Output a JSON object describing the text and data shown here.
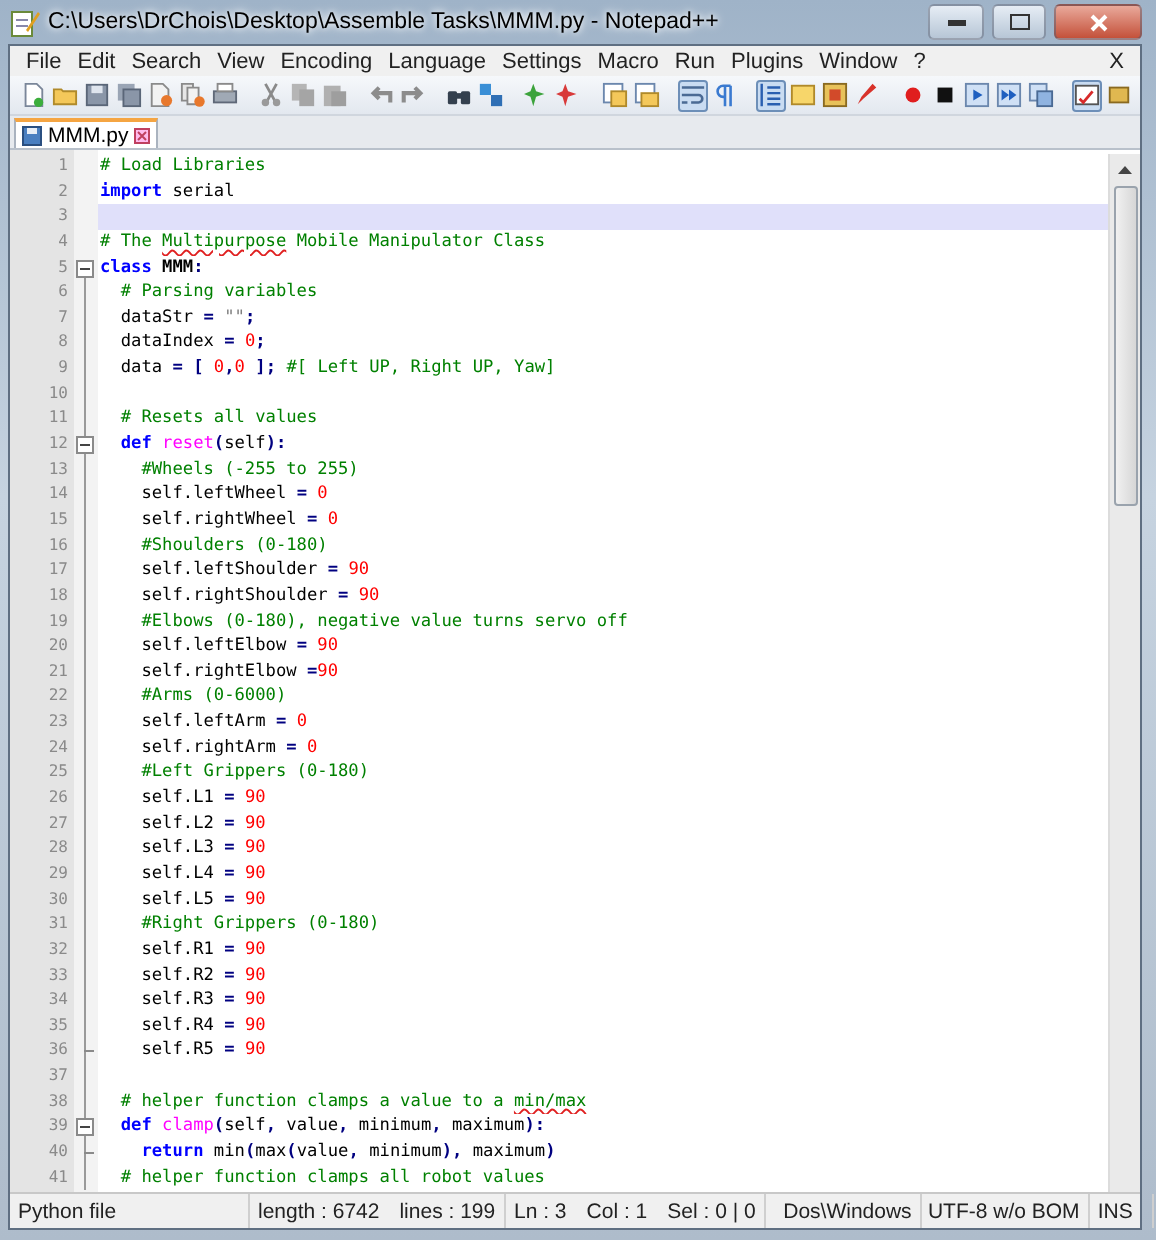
{
  "window": {
    "title": "C:\\Users\\DrChois\\Desktop\\Assemble Tasks\\MMM.py - Notepad++"
  },
  "menu": [
    {
      "label": "File"
    },
    {
      "label": "Edit"
    },
    {
      "label": "Search"
    },
    {
      "label": "View"
    },
    {
      "label": "Encoding"
    },
    {
      "label": "Language"
    },
    {
      "label": "Settings"
    },
    {
      "label": "Macro"
    },
    {
      "label": "Run"
    },
    {
      "label": "Plugins"
    },
    {
      "label": "Window"
    },
    {
      "label": "?"
    }
  ],
  "menu_close": "X",
  "toolbar": [
    {
      "kind": "new",
      "pressed": false
    },
    {
      "kind": "open",
      "pressed": false
    },
    {
      "kind": "save",
      "pressed": false
    },
    {
      "kind": "saveall",
      "pressed": false
    },
    {
      "kind": "close",
      "pressed": false
    },
    {
      "kind": "closeall",
      "pressed": false
    },
    {
      "kind": "print",
      "pressed": false
    },
    {
      "kind": "sep"
    },
    {
      "kind": "cut",
      "pressed": false
    },
    {
      "kind": "copy",
      "pressed": false
    },
    {
      "kind": "paste",
      "pressed": false
    },
    {
      "kind": "sep"
    },
    {
      "kind": "undo",
      "pressed": false
    },
    {
      "kind": "redo",
      "pressed": false
    },
    {
      "kind": "sep"
    },
    {
      "kind": "find",
      "pressed": false
    },
    {
      "kind": "replace",
      "pressed": false
    },
    {
      "kind": "sep"
    },
    {
      "kind": "zoomin",
      "pressed": false
    },
    {
      "kind": "zoomout",
      "pressed": false
    },
    {
      "kind": "sep"
    },
    {
      "kind": "syncv",
      "pressed": false
    },
    {
      "kind": "synch",
      "pressed": false
    },
    {
      "kind": "sep"
    },
    {
      "kind": "wrap",
      "pressed": true
    },
    {
      "kind": "pilcrow",
      "pressed": false
    },
    {
      "kind": "sep"
    },
    {
      "kind": "guide",
      "pressed": true
    },
    {
      "kind": "panel",
      "pressed": false
    },
    {
      "kind": "docmap",
      "pressed": false
    },
    {
      "kind": "pen",
      "pressed": false
    },
    {
      "kind": "sep"
    },
    {
      "kind": "record",
      "pressed": false
    },
    {
      "kind": "stop",
      "pressed": false
    },
    {
      "kind": "play",
      "pressed": false
    },
    {
      "kind": "playmulti",
      "pressed": false
    },
    {
      "kind": "savemacro",
      "pressed": false
    },
    {
      "kind": "sep"
    },
    {
      "kind": "spell",
      "pressed": true
    },
    {
      "kind": "extra",
      "pressed": false
    }
  ],
  "tabs": [
    {
      "label": "MMM.py",
      "selected": true
    }
  ],
  "editor": {
    "lines": [
      {
        "number": "1",
        "current": false,
        "tokens": [
          {
            "kind": "comment",
            "text": "# Load Libraries"
          }
        ]
      },
      {
        "number": "2",
        "current": false,
        "tokens": [
          {
            "kind": "keyword",
            "text": "import"
          },
          {
            "kind": "plain",
            "text": " serial"
          }
        ]
      },
      {
        "number": "3",
        "current": true
      },
      {
        "number": "4",
        "current": false,
        "tokens": [
          {
            "kind": "comment",
            "text": "# The "
          },
          {
            "kind": "typo",
            "text": "Multipurpose"
          },
          {
            "kind": "comment",
            "text": " Mobile Manipulator Class"
          }
        ]
      },
      {
        "number": "5",
        "current": false,
        "fold_start": true,
        "tokens": [
          {
            "kind": "keyword",
            "text": "class"
          },
          {
            "kind": "classname",
            "text": " MMM"
          },
          {
            "kind": "operator",
            "text": ":"
          }
        ]
      },
      {
        "number": "6",
        "current": false,
        "tokens": [
          {
            "kind": "comment",
            "text": "  # Parsing variables"
          }
        ]
      },
      {
        "number": "7",
        "current": false,
        "tokens": [
          {
            "kind": "plain",
            "text": "  dataStr "
          },
          {
            "kind": "operator",
            "text": "="
          },
          {
            "kind": "string",
            "text": " \"\""
          },
          {
            "kind": "operator",
            "text": ";"
          }
        ]
      },
      {
        "number": "8",
        "current": false,
        "tokens": [
          {
            "kind": "plain",
            "text": "  dataIndex "
          },
          {
            "kind": "operator",
            "text": "="
          },
          {
            "kind": "number",
            "text": " 0"
          },
          {
            "kind": "operator",
            "text": ";"
          }
        ]
      },
      {
        "number": "9",
        "current": false,
        "tokens": [
          {
            "kind": "plain",
            "text": "  data "
          },
          {
            "kind": "operator",
            "text": "= ["
          },
          {
            "kind": "number",
            "text": " 0"
          },
          {
            "kind": "operator",
            "text": ","
          },
          {
            "kind": "number",
            "text": "0"
          },
          {
            "kind": "operator",
            "text": " ];"
          },
          {
            "kind": "comment",
            "text": " #[ Left UP, Right UP, Yaw]"
          }
        ]
      },
      {
        "number": "10",
        "current": false
      },
      {
        "number": "11",
        "current": false,
        "tokens": [
          {
            "kind": "comment",
            "text": "  # Resets all values"
          }
        ]
      },
      {
        "number": "12",
        "current": false,
        "fold_start": true,
        "tokens": [
          {
            "kind": "keyword",
            "text": "  def"
          },
          {
            "kind": "function",
            "text": " reset"
          },
          {
            "kind": "operator",
            "text": "("
          },
          {
            "kind": "plain",
            "text": "self"
          },
          {
            "kind": "operator",
            "text": "):"
          }
        ]
      },
      {
        "number": "13",
        "current": false,
        "tokens": [
          {
            "kind": "comment",
            "text": "    #Wheels (-255 to 255)"
          }
        ]
      },
      {
        "number": "14",
        "current": false,
        "tokens": [
          {
            "kind": "plain",
            "text": "    self.leftWheel "
          },
          {
            "kind": "operator",
            "text": "="
          },
          {
            "kind": "number",
            "text": " 0"
          }
        ]
      },
      {
        "number": "15",
        "current": false,
        "tokens": [
          {
            "kind": "plain",
            "text": "    self.rightWheel "
          },
          {
            "kind": "operator",
            "text": "="
          },
          {
            "kind": "number",
            "text": " 0"
          }
        ]
      },
      {
        "number": "16",
        "current": false,
        "tokens": [
          {
            "kind": "comment",
            "text": "    #Shoulders (0-180)"
          }
        ]
      },
      {
        "number": "17",
        "current": false,
        "tokens": [
          {
            "kind": "plain",
            "text": "    self.leftShoulder "
          },
          {
            "kind": "operator",
            "text": "="
          },
          {
            "kind": "number",
            "text": " 90"
          }
        ]
      },
      {
        "number": "18",
        "current": false,
        "tokens": [
          {
            "kind": "plain",
            "text": "    self.rightShoulder "
          },
          {
            "kind": "operator",
            "text": "="
          },
          {
            "kind": "number",
            "text": " 90"
          }
        ]
      },
      {
        "number": "19",
        "current": false,
        "tokens": [
          {
            "kind": "comment",
            "text": "    #Elbows (0-180), negative value turns servo off"
          }
        ]
      },
      {
        "number": "20",
        "current": false,
        "tokens": [
          {
            "kind": "plain",
            "text": "    self.leftElbow "
          },
          {
            "kind": "operator",
            "text": "="
          },
          {
            "kind": "number",
            "text": " 90"
          }
        ]
      },
      {
        "number": "21",
        "current": false,
        "tokens": [
          {
            "kind": "plain",
            "text": "    self.rightElbow "
          },
          {
            "kind": "operator",
            "text": "="
          },
          {
            "kind": "number",
            "text": "90"
          }
        ]
      },
      {
        "number": "22",
        "current": false,
        "tokens": [
          {
            "kind": "comment",
            "text": "    #Arms (0-6000)"
          }
        ]
      },
      {
        "number": "23",
        "current": false,
        "tokens": [
          {
            "kind": "plain",
            "text": "    self.leftArm "
          },
          {
            "kind": "operator",
            "text": "="
          },
          {
            "kind": "number",
            "text": " 0"
          }
        ]
      },
      {
        "number": "24",
        "current": false,
        "tokens": [
          {
            "kind": "plain",
            "text": "    self.rightArm "
          },
          {
            "kind": "operator",
            "text": "="
          },
          {
            "kind": "number",
            "text": " 0"
          }
        ]
      },
      {
        "number": "25",
        "current": false,
        "tokens": [
          {
            "kind": "comment",
            "text": "    #Left Grippers (0-180)"
          }
        ]
      },
      {
        "number": "26",
        "current": false,
        "tokens": [
          {
            "kind": "plain",
            "text": "    self.L1 "
          },
          {
            "kind": "operator",
            "text": "="
          },
          {
            "kind": "number",
            "text": " 90"
          }
        ]
      },
      {
        "number": "27",
        "current": false,
        "tokens": [
          {
            "kind": "plain",
            "text": "    self.L2 "
          },
          {
            "kind": "operator",
            "text": "="
          },
          {
            "kind": "number",
            "text": " 90"
          }
        ]
      },
      {
        "number": "28",
        "current": false,
        "tokens": [
          {
            "kind": "plain",
            "text": "    self.L3 "
          },
          {
            "kind": "operator",
            "text": "="
          },
          {
            "kind": "number",
            "text": " 90"
          }
        ]
      },
      {
        "number": "29",
        "current": false,
        "tokens": [
          {
            "kind": "plain",
            "text": "    self.L4 "
          },
          {
            "kind": "operator",
            "text": "="
          },
          {
            "kind": "number",
            "text": " 90"
          }
        ]
      },
      {
        "number": "30",
        "current": false,
        "tokens": [
          {
            "kind": "plain",
            "text": "    self.L5 "
          },
          {
            "kind": "operator",
            "text": "="
          },
          {
            "kind": "number",
            "text": " 90"
          }
        ]
      },
      {
        "number": "31",
        "current": false,
        "tokens": [
          {
            "kind": "comment",
            "text": "    #Right Grippers (0-180)"
          }
        ]
      },
      {
        "number": "32",
        "current": false,
        "tokens": [
          {
            "kind": "plain",
            "text": "    self.R1 "
          },
          {
            "kind": "operator",
            "text": "="
          },
          {
            "kind": "number",
            "text": " 90"
          }
        ]
      },
      {
        "number": "33",
        "current": false,
        "tokens": [
          {
            "kind": "plain",
            "text": "    self.R2 "
          },
          {
            "kind": "operator",
            "text": "="
          },
          {
            "kind": "number",
            "text": " 90"
          }
        ]
      },
      {
        "number": "34",
        "current": false,
        "tokens": [
          {
            "kind": "plain",
            "text": "    self.R3 "
          },
          {
            "kind": "operator",
            "text": "="
          },
          {
            "kind": "number",
            "text": " 90"
          }
        ]
      },
      {
        "number": "35",
        "current": false,
        "tokens": [
          {
            "kind": "plain",
            "text": "    self.R4 "
          },
          {
            "kind": "operator",
            "text": "="
          },
          {
            "kind": "number",
            "text": " 90"
          }
        ]
      },
      {
        "number": "36",
        "current": false,
        "fold_end": true,
        "tokens": [
          {
            "kind": "plain",
            "text": "    self.R5 "
          },
          {
            "kind": "operator",
            "text": "="
          },
          {
            "kind": "number",
            "text": " 90"
          }
        ]
      },
      {
        "number": "37",
        "current": false
      },
      {
        "number": "38",
        "current": false,
        "tokens": [
          {
            "kind": "comment",
            "text": "  # helper function clamps a value to a "
          },
          {
            "kind": "typo",
            "text": "min/max"
          }
        ]
      },
      {
        "number": "39",
        "current": false,
        "fold_start": true,
        "tokens": [
          {
            "kind": "keyword",
            "text": "  def"
          },
          {
            "kind": "function",
            "text": " clamp"
          },
          {
            "kind": "operator",
            "text": "("
          },
          {
            "kind": "plain",
            "text": "self"
          },
          {
            "kind": "operator",
            "text": ","
          },
          {
            "kind": "plain",
            "text": " value"
          },
          {
            "kind": "operator",
            "text": ","
          },
          {
            "kind": "plain",
            "text": " minimum"
          },
          {
            "kind": "operator",
            "text": ","
          },
          {
            "kind": "plain",
            "text": " maximum"
          },
          {
            "kind": "operator",
            "text": "):"
          }
        ]
      },
      {
        "number": "40",
        "current": false,
        "fold_end": true,
        "tokens": [
          {
            "kind": "keyword",
            "text": "    return"
          },
          {
            "kind": "plain",
            "text": " min"
          },
          {
            "kind": "operator",
            "text": "("
          },
          {
            "kind": "plain",
            "text": "max"
          },
          {
            "kind": "operator",
            "text": "("
          },
          {
            "kind": "plain",
            "text": "value"
          },
          {
            "kind": "operator",
            "text": ","
          },
          {
            "kind": "plain",
            "text": " minimum"
          },
          {
            "kind": "operator",
            "text": "),"
          },
          {
            "kind": "plain",
            "text": " maximum"
          },
          {
            "kind": "operator",
            "text": ")"
          }
        ]
      },
      {
        "number": "41",
        "current": false,
        "tokens": [
          {
            "kind": "comment",
            "text": "  # helper function clamps all robot values"
          }
        ]
      }
    ]
  },
  "status_bar": {
    "file_type": "Python file",
    "length": "length : 6742",
    "lines": "lines : 199",
    "line": "Ln : 3",
    "column": "Col : 1",
    "selection": "Sel : 0 | 0",
    "line_endings": "Dos\\Windows",
    "encoding": "UTF-8 w/o BOM",
    "mode": "INS"
  }
}
